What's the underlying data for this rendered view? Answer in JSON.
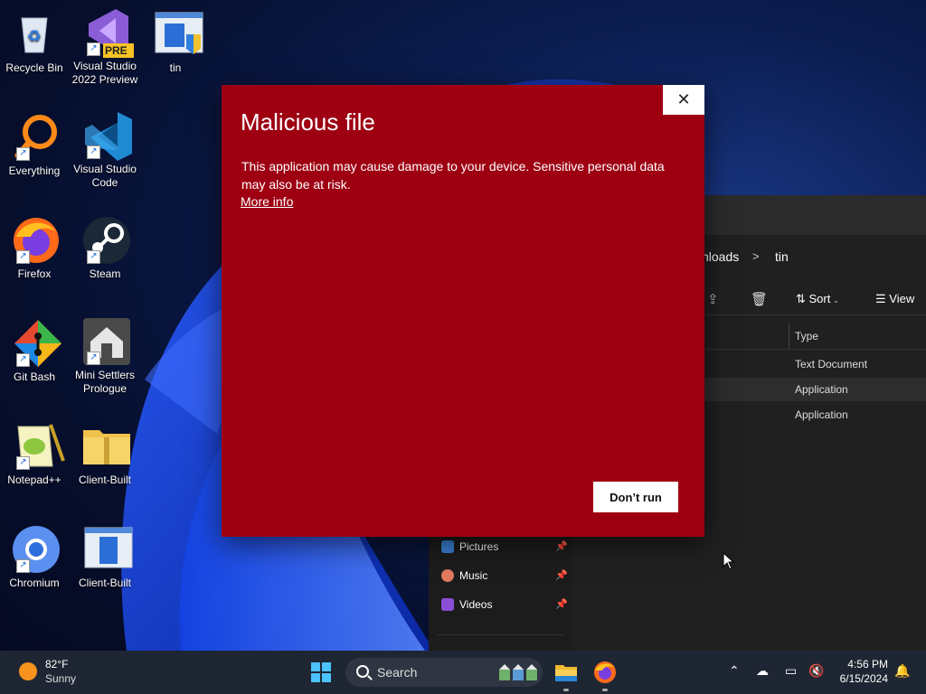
{
  "desktop_icons": [
    {
      "label": "Recycle Bin"
    },
    {
      "label": "Visual Studio 2022 Preview",
      "badge": "PRE"
    },
    {
      "label": "tin"
    },
    {
      "label": "Everything"
    },
    {
      "label": "Visual Studio Code"
    },
    {
      "label": "Firefox"
    },
    {
      "label": "Steam"
    },
    {
      "label": "Git Bash"
    },
    {
      "label": "Mini Settlers Prologue"
    },
    {
      "label": "Notepad++"
    },
    {
      "label": "Client-Built"
    },
    {
      "label": "Chromium"
    },
    {
      "label": "Client-Built"
    }
  ],
  "dialog": {
    "title": "Malicious file",
    "message": "This application may cause damage to your device. Sensitive personal data may also be at risk.",
    "more_info": "More info",
    "dont_run": "Don’t run",
    "close": "✕",
    "background": "#9e0012"
  },
  "explorer": {
    "breadcrumb_partial": "nloads",
    "breadcrumb_sep": ">",
    "breadcrumb_current": "tin",
    "sort_label": "Sort",
    "view_label": "View",
    "type_header": "Type",
    "rows": [
      "Text Document",
      "Application",
      "Application"
    ],
    "nav_items": [
      {
        "label": "Pictures"
      },
      {
        "label": "Music"
      },
      {
        "label": "Videos"
      }
    ]
  },
  "taskbar": {
    "temp": "82°F",
    "condition": "Sunny",
    "search_label": "Search",
    "time": "4:56 PM",
    "date": "6/15/2024"
  }
}
